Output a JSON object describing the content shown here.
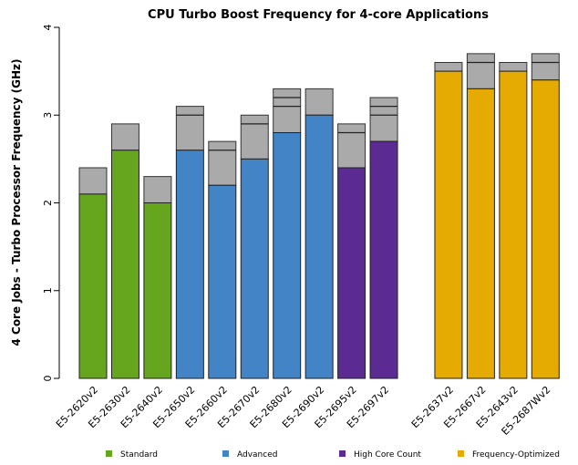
{
  "chart_data": {
    "type": "bar",
    "stacked": true,
    "title": "CPU Turbo Boost Frequency for 4-core Applications",
    "xlabel": "",
    "ylabel": "4 Core Jobs - Turbo Processor Frequency (GHz)",
    "ylim": [
      0,
      4
    ],
    "yticks": [
      "0",
      "1",
      "2",
      "3",
      "4"
    ],
    "grid": false,
    "legend_placement": "bottom",
    "turbo_color": "#aaaaaa",
    "legend": [
      {
        "label": "Standard",
        "color": "#66a61e"
      },
      {
        "label": "Advanced",
        "color": "#4384c6"
      },
      {
        "label": "High Core Count",
        "color": "#5b2a92"
      },
      {
        "label": "Frequency-Optimized",
        "color": "#e6ab02"
      }
    ],
    "bars": [
      {
        "category": "E5-2620v2",
        "group": 0,
        "base": 2.1,
        "turbo_levels": [
          2.4
        ]
      },
      {
        "category": "E5-2630v2",
        "group": 0,
        "base": 2.6,
        "turbo_levels": [
          2.9
        ]
      },
      {
        "category": "E5-2640v2",
        "group": 0,
        "base": 2.0,
        "turbo_levels": [
          2.3
        ]
      },
      {
        "category": "E5-2650v2",
        "group": 1,
        "base": 2.6,
        "turbo_levels": [
          3.0,
          3.1
        ]
      },
      {
        "category": "E5-2660v2",
        "group": 1,
        "base": 2.2,
        "turbo_levels": [
          2.6,
          2.7
        ]
      },
      {
        "category": "E5-2670v2",
        "group": 1,
        "base": 2.5,
        "turbo_levels": [
          2.9,
          3.0
        ]
      },
      {
        "category": "E5-2680v2",
        "group": 1,
        "base": 2.8,
        "turbo_levels": [
          3.1,
          3.2,
          3.3
        ]
      },
      {
        "category": "E5-2690v2",
        "group": 1,
        "base": 3.0,
        "turbo_levels": [
          3.3
        ]
      },
      {
        "category": "E5-2695v2",
        "group": 2,
        "base": 2.4,
        "turbo_levels": [
          2.8,
          2.9
        ]
      },
      {
        "category": "E5-2697v2",
        "group": 2,
        "base": 2.7,
        "turbo_levels": [
          3.0,
          3.1,
          3.2
        ]
      },
      {
        "category": "E5-2637v2",
        "group": 3,
        "base": 3.5,
        "turbo_levels": [
          3.6
        ]
      },
      {
        "category": "E5-2667v2",
        "group": 3,
        "base": 3.3,
        "turbo_levels": [
          3.6,
          3.7
        ]
      },
      {
        "category": "E5-2643v2",
        "group": 3,
        "base": 3.5,
        "turbo_levels": [
          3.6
        ]
      },
      {
        "category": "E5-2687Wv2",
        "group": 3,
        "base": 3.4,
        "turbo_levels": [
          3.6,
          3.7
        ]
      }
    ]
  }
}
